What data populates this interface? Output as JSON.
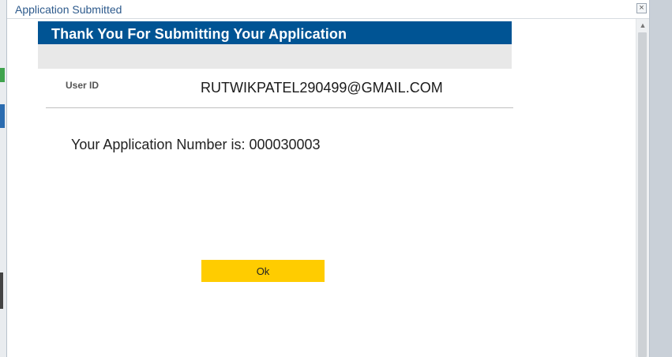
{
  "dialog": {
    "title": "Application Submitted",
    "close_glyph": "×"
  },
  "header": {
    "title": "Thank You For Submitting Your Application"
  },
  "user": {
    "label": "User ID",
    "value": "RUTWIKPATEL290499@GMAIL.COM"
  },
  "application": {
    "message": "Your Application Number is: 000030003"
  },
  "actions": {
    "ok_label": "Ok"
  },
  "scrollbar": {
    "up_glyph": "▲"
  },
  "colors": {
    "header_bg": "#005494",
    "button_bg": "#ffcc00",
    "title_text": "#2d5a8c"
  }
}
